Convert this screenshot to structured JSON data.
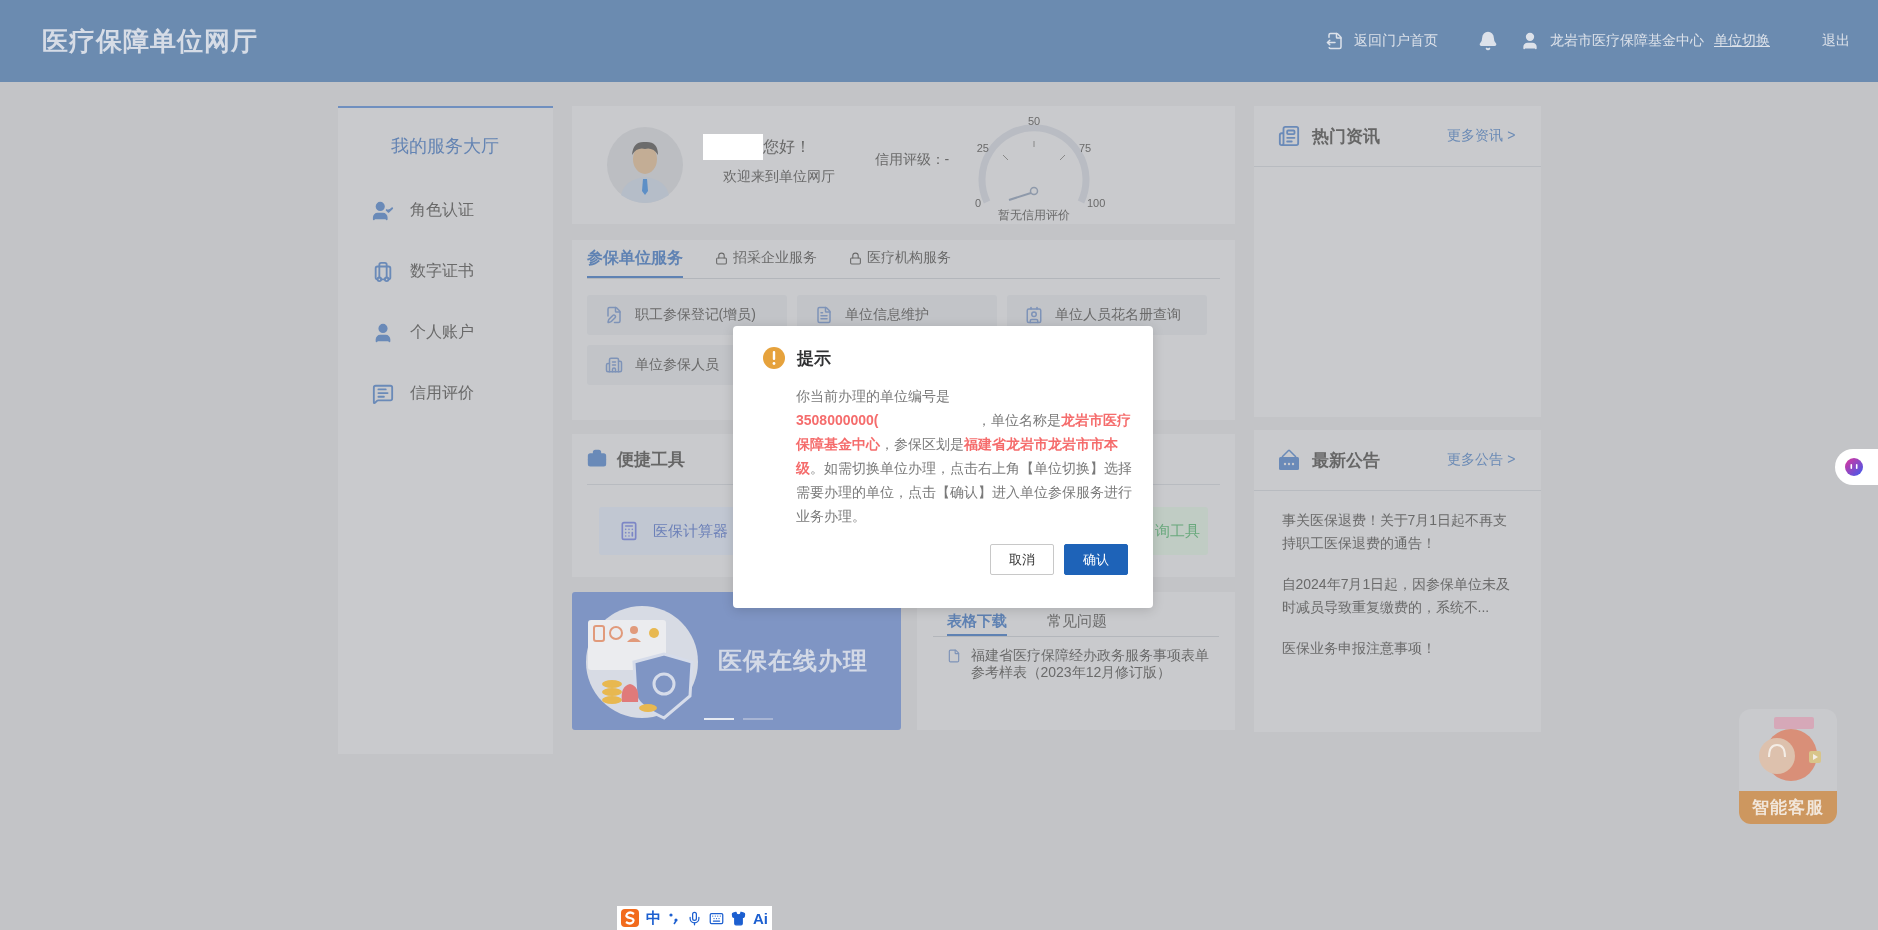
{
  "header": {
    "title": "医疗保障单位网厅",
    "home_link": "返回门户首页",
    "unit_name": "龙岩市医疗保障基金中心",
    "switch_link": "单位切换",
    "logout": "退出"
  },
  "sidebar": {
    "title": "我的服务大厅",
    "items": [
      {
        "kind": "role",
        "label": "角色认证"
      },
      {
        "kind": "certificate",
        "label": "数字证书"
      },
      {
        "kind": "account",
        "label": "个人账户"
      },
      {
        "kind": "credit",
        "label": "信用评价"
      }
    ]
  },
  "profile": {
    "greeting": "您好！",
    "welcome": "欢迎来到单位网厅",
    "credit_label": "信用评级：-",
    "gauge_ticks": [
      "0",
      "25",
      "50",
      "75",
      "100"
    ],
    "gauge_caption": "暂无信用评价"
  },
  "services": {
    "tabs": [
      {
        "label": "参保单位服务",
        "selected": true,
        "locked": false
      },
      {
        "label": "招采企业服务",
        "selected": false,
        "locked": true
      },
      {
        "label": "医疗机构服务",
        "selected": false,
        "locked": true
      }
    ],
    "items": [
      {
        "kind": "register",
        "label": "职工参保登记(增员)"
      },
      {
        "kind": "info",
        "label": "单位信息维护"
      },
      {
        "kind": "roster",
        "label": "单位人员花名册查询"
      },
      {
        "kind": "building",
        "label": "单位参保人员"
      }
    ]
  },
  "tools": {
    "title": "便捷工具",
    "items": [
      {
        "kind": "calculator",
        "label": "医保计算器"
      },
      {
        "kind": "query",
        "label": "询工具"
      }
    ]
  },
  "banner": {
    "title": "医保在线办理",
    "slides": [
      {
        "selected": true
      },
      {
        "selected": false
      }
    ]
  },
  "forms": {
    "tabs": [
      {
        "label": "表格下载",
        "selected": true
      },
      {
        "label": "常见问题",
        "selected": false
      }
    ],
    "items": [
      "福建省医疗保障经办政务服务事项表单参考样表（2023年12月修订版）"
    ]
  },
  "hot_news": {
    "title": "热门资讯",
    "more": "更多资讯 >"
  },
  "notices": {
    "title": "最新公告",
    "more": "更多公告 >",
    "items": [
      "事关医保退费！关于7月1日起不再支持职工医保退费的通告！",
      "自2024年7月1日起，因参保单位未及时减员导致重复缴费的，系统不...",
      "医保业务申报注意事项！"
    ]
  },
  "dialog": {
    "title": "提示",
    "intro": "你当前办理的单位编号是",
    "code": "3508000000(",
    "body": "，单位名称是**龙岩市医疗保障基金中心**，参保区划是**福建省龙岩市龙岩市市本级**。如需切换单位办理，点击右上角【单位切换】选择需要办理的单位，点击【确认】进入单位参保服务进行业务办理。",
    "buttons": [
      {
        "kind": "secondary",
        "label": "取消"
      },
      {
        "kind": "primary",
        "label": "确认"
      }
    ]
  },
  "assistant": {
    "label": "智能客服"
  },
  "ime": {
    "mode": "中",
    "ai": "Ai"
  }
}
